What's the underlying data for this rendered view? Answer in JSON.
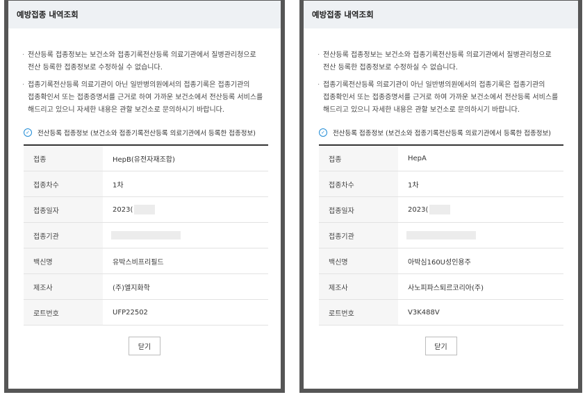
{
  "modals": [
    {
      "title": "예방접종 내역조회",
      "notices": [
        "전산등록 접종정보는 보건소와 접종기록전산등록 의료기관에서 질병관리청으로 전산 등록한 접종정보로 수정하실 수 없습니다.",
        "접종기록전산등록 의료기관이 아닌 일반병의원에서의 접종기록은 접종기관의 접종확인서 또는 접종증명서를 근거로 하여 가까운 보건소에서 전산등록 서비스를 해드리고 있으니 자세한 내용은 관할 보건소로 문의하시기 바랍니다."
      ],
      "section_title": "전산등록 접종정보 (보건소와 접종기록전산등록 의료기관에서 등록한 접종정보)",
      "rows": [
        {
          "label": "접종",
          "value": "HepB(유전자재조합)"
        },
        {
          "label": "접종차수",
          "value": "1차"
        },
        {
          "label": "접종일자",
          "value": "2023("
        },
        {
          "label": "접종기관",
          "value": ""
        },
        {
          "label": "백신명",
          "value": "유박스비프리필드"
        },
        {
          "label": "제조사",
          "value": "(주)엘지화학"
        },
        {
          "label": "로트번호",
          "value": "UFP22502"
        }
      ],
      "close_label": "닫기"
    },
    {
      "title": "예방접종 내역조회",
      "notices": [
        "전산등록 접종정보는 보건소와 접종기록전산등록 의료기관에서 질병관리청으로 전산 등록한 접종정보로 수정하실 수 없습니다.",
        "접종기록전산등록 의료기관이 아닌 일반병의원에서의 접종기록은 접종기관의 접종확인서 또는 접종증명서를 근거로 하여 가까운 보건소에서 전산등록 서비스를 해드리고 있으니 자세한 내용은 관할 보건소로 문의하시기 바랍니다."
      ],
      "section_title": "전산등록 접종정보 (보건소와 접종기록전산등록 의료기관에서 등록한 접종정보)",
      "rows": [
        {
          "label": "접종",
          "value": "HepA"
        },
        {
          "label": "접종차수",
          "value": "1차"
        },
        {
          "label": "접종일자",
          "value": "2023("
        },
        {
          "label": "접종기관",
          "value": ""
        },
        {
          "label": "백신명",
          "value": "아박심160U성인용주"
        },
        {
          "label": "제조사",
          "value": "사노피파스퇴르코리아(주)"
        },
        {
          "label": "로트번호",
          "value": "V3K488V"
        }
      ],
      "close_label": "닫기"
    }
  ],
  "colors": {
    "header_bg": "#eef1f4",
    "modal_border": "#565656",
    "check_icon": "#1f8bd6"
  }
}
